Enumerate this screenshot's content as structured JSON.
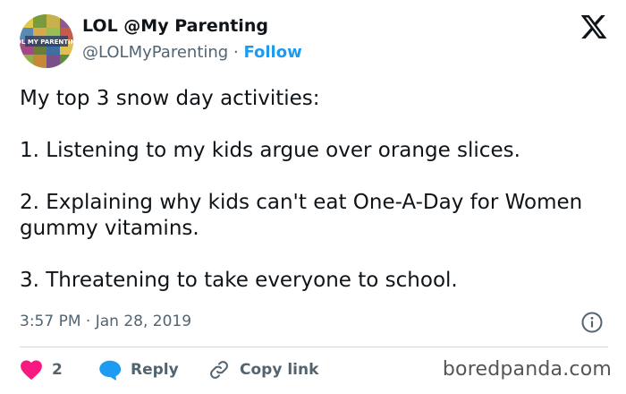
{
  "author": {
    "display_name": "LOL @My Parenting",
    "handle": "@LOLMyParenting",
    "separator": "·",
    "follow_label": "Follow",
    "avatar_text": "LOL MY PARENTING"
  },
  "tweet": {
    "lines": [
      "My top 3 snow day activities:",
      "1. Listening to my kids argue over orange slices.",
      "2. Explaining why kids can't eat One-A-Day for Women gummy vitamins.",
      "3. Threatening to take everyone to school."
    ],
    "time": "3:57 PM",
    "date_separator": "·",
    "date": "Jan 28, 2019"
  },
  "actions": {
    "like_count": "2",
    "reply_label": "Reply",
    "copy_label": "Copy link"
  },
  "watermark": "boredpanda.com",
  "colors": {
    "accent": "#1d9bf0",
    "like": "#f91880",
    "text": "#0f1419",
    "muted": "#536471",
    "divider": "#cfd9de"
  },
  "icons": {
    "brand": "x-logo-icon",
    "info": "info-icon",
    "like": "heart-icon",
    "reply": "speech-bubble-icon",
    "copy": "link-icon"
  }
}
